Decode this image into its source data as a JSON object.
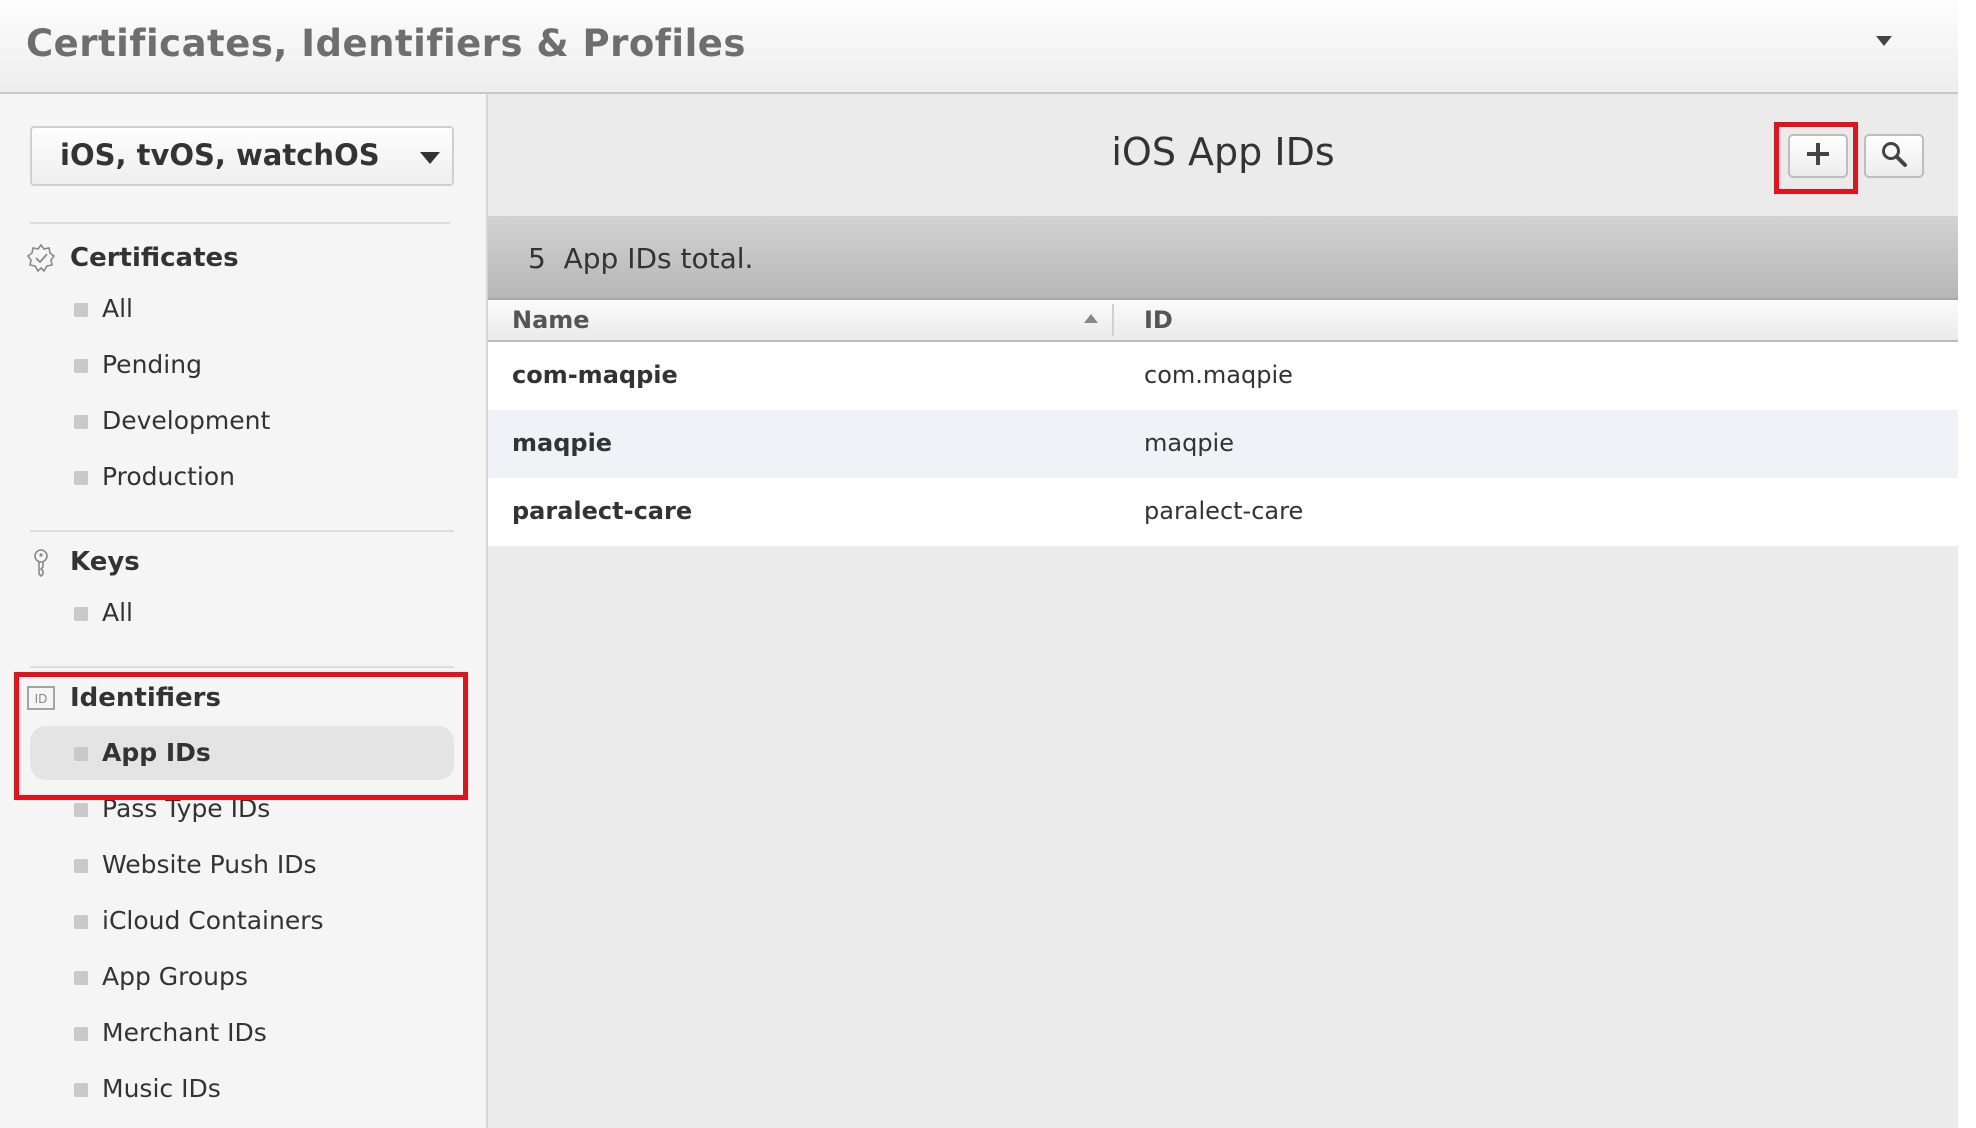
{
  "header": {
    "title": "Certificates, Identifiers & Profiles"
  },
  "sidebar": {
    "platform": "iOS, tvOS, watchOS",
    "sections": {
      "certificates": {
        "label": "Certificates",
        "items": [
          "All",
          "Pending",
          "Development",
          "Production"
        ]
      },
      "keys": {
        "label": "Keys",
        "items": [
          "All"
        ]
      },
      "identifiers": {
        "label": "Identifiers",
        "items": [
          "App IDs",
          "Pass Type IDs",
          "Website Push IDs",
          "iCloud Containers",
          "App Groups",
          "Merchant IDs",
          "Music IDs"
        ],
        "selected": "App IDs"
      }
    }
  },
  "main": {
    "title": "iOS App IDs",
    "summary": "5  App IDs total.",
    "columns": {
      "name": "Name",
      "id": "ID"
    },
    "rows": [
      {
        "name": "com-maqpie",
        "id": "com.maqpie"
      },
      {
        "name": "maqpie",
        "id": "maqpie"
      },
      {
        "name": "paralect-care",
        "id": "paralect-care"
      }
    ]
  },
  "colors": {
    "highlight": "#e3121c",
    "sidebar_bg": "#f5f5f5",
    "selected_item_bg": "#e4e4e4",
    "alt_row_bg": "#eff2f7"
  },
  "icons": {
    "certificates": "badge-check-icon",
    "keys": "key-icon",
    "identifiers": "id-icon",
    "add": "plus-icon",
    "search": "search-icon"
  }
}
